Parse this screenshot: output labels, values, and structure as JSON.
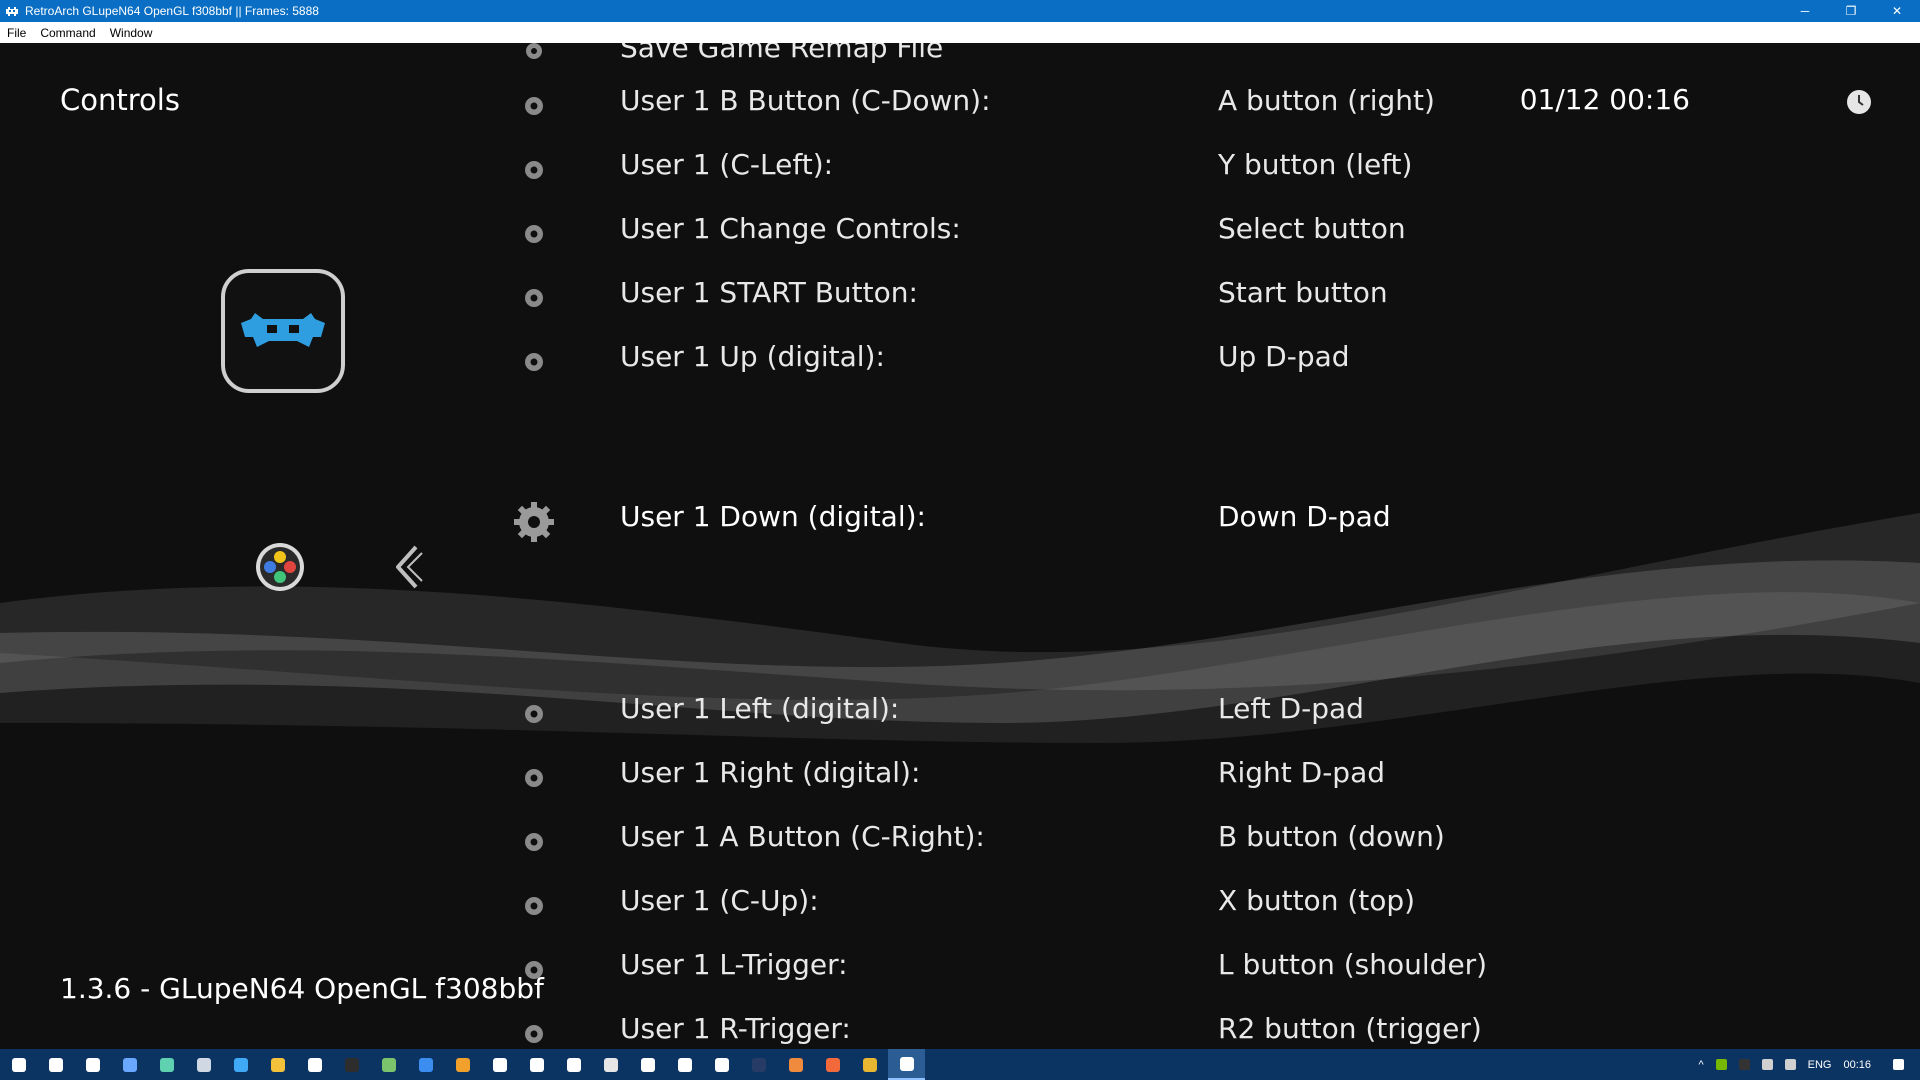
{
  "window": {
    "title": "RetroArch GLupeN64 OpenGL f308bbf || Frames: 5888",
    "minimize_label": "─",
    "restore_label": "❐",
    "close_label": "✕"
  },
  "menubar": {
    "items": [
      "File",
      "Command",
      "Window"
    ]
  },
  "header": {
    "title": "Controls",
    "clock": "01/12 00:16"
  },
  "footer": {
    "version": "1.3.6 - GLupeN64 OpenGL f308bbf"
  },
  "menu": {
    "clipped_item": "Save Game Remap File",
    "selected": {
      "label": "User 1 Down (digital):",
      "value": "Down D-pad"
    },
    "above": [
      {
        "label": "User 1 B Button (C-Down):",
        "value": "A button (right)"
      },
      {
        "label": "User 1 (C-Left):",
        "value": "Y button (left)"
      },
      {
        "label": "User 1 Change Controls:",
        "value": "Select button"
      },
      {
        "label": "User 1 START Button:",
        "value": "Start button"
      },
      {
        "label": "User 1 Up (digital):",
        "value": "Up D-pad"
      }
    ],
    "below": [
      {
        "label": "User 1 Left (digital):",
        "value": "Left D-pad"
      },
      {
        "label": "User 1 Right (digital):",
        "value": "Right D-pad"
      },
      {
        "label": "User 1 A Button (C-Right):",
        "value": "B button (down)"
      },
      {
        "label": "User 1 (C-Up):",
        "value": "X button (top)"
      },
      {
        "label": "User 1 L-Trigger:",
        "value": "L button (shoulder)"
      },
      {
        "label": "User 1 R-Trigger:",
        "value": "R2 button (trigger)"
      }
    ]
  },
  "icons": {
    "logo": "retroarch-invader-icon",
    "controller": "gamepad-icon",
    "back": "chevron-left-icon",
    "setting": "gear-icon",
    "clock": "clock-icon"
  },
  "taskbar": {
    "tray": {
      "language": "ENG",
      "time": "00:16",
      "show_hidden": "^"
    },
    "apps": [
      {
        "name": "start-button",
        "color": "#ffffff"
      },
      {
        "name": "cortana-search",
        "color": "#ffffff"
      },
      {
        "name": "task-view",
        "color": "#ffffff"
      },
      {
        "name": "app-diamond",
        "color": "#6aa7ff"
      },
      {
        "name": "app-cube",
        "color": "#5fd0b0"
      },
      {
        "name": "steam",
        "color": "#cfd8e3"
      },
      {
        "name": "edge",
        "color": "#3fa9f5"
      },
      {
        "name": "file-explorer",
        "color": "#f3c13a"
      },
      {
        "name": "store",
        "color": "#ffffff"
      },
      {
        "name": "terminal",
        "color": "#2d2d2d"
      },
      {
        "name": "app-green",
        "color": "#7cc46b"
      },
      {
        "name": "app-play",
        "color": "#3c8df0"
      },
      {
        "name": "app-orange",
        "color": "#f0a02b"
      },
      {
        "name": "app-hc",
        "color": "#ffffff"
      },
      {
        "name": "xbox",
        "color": "#ffffff"
      },
      {
        "name": "app-crown",
        "color": "#ffffff"
      },
      {
        "name": "app-tile",
        "color": "#e6e6e6"
      },
      {
        "name": "app-gamepad",
        "color": "#ffffff"
      },
      {
        "name": "app-stripe",
        "color": "#ffffff"
      },
      {
        "name": "app-sword",
        "color": "#ffffff"
      },
      {
        "name": "app-dark",
        "color": "#263c66"
      },
      {
        "name": "app-shield",
        "color": "#f08a3c"
      },
      {
        "name": "app-badge",
        "color": "#f26a3c"
      },
      {
        "name": "chrome",
        "color": "#e9b632"
      },
      {
        "name": "retroarch-taskbar",
        "color": "#ffffff"
      }
    ]
  }
}
